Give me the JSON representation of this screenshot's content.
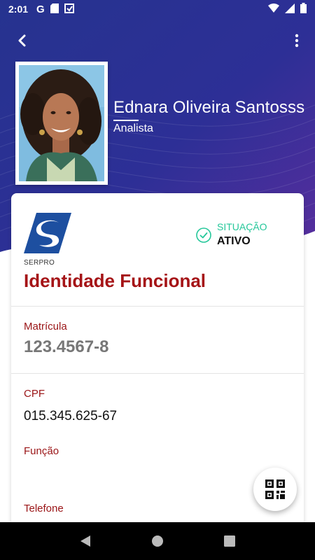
{
  "status_bar": {
    "time": "2:01",
    "left_icons": [
      "google-icon",
      "sd-card-icon",
      "cast-icon"
    ],
    "right_icons": [
      "wifi-icon",
      "signal-icon",
      "battery-icon"
    ]
  },
  "appbar": {
    "back_icon": "arrow-back-icon",
    "menu_icon": "more-vert-icon"
  },
  "profile": {
    "name": "Ednara Oliveira Santosss",
    "role": "Analista"
  },
  "card": {
    "logo_text": "SERPRO",
    "situacao_label": "SITUAÇÃO",
    "situacao_value": "ATIVO",
    "title": "Identidade Funcional",
    "fields": {
      "matricula_label": "Matrícula",
      "matricula_value": "123.4567-8",
      "cpf_label": "CPF",
      "cpf_value": "015.345.625-67",
      "funcao_label": "Função",
      "funcao_value": "",
      "telefone_label": "Telefone"
    }
  },
  "fab": {
    "icon": "qr-code-icon"
  },
  "colors": {
    "header_primary": "#2a2f8f",
    "header_secondary": "#4a2a9a",
    "title_red": "#a51417",
    "status_green": "#25c79a",
    "logo_blue": "#1d4fa0"
  }
}
